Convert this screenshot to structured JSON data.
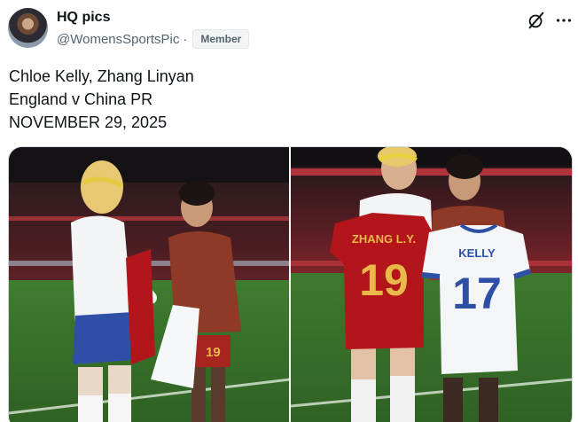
{
  "author": {
    "display_name": "HQ pics",
    "handle": "@WomensSportsPic",
    "separator": "·",
    "badge": "Member"
  },
  "actions": {
    "grok_icon": "grok-icon",
    "more_icon": "more-icon"
  },
  "tweet": {
    "lines": [
      "Chloe Kelly, Zhang Linyan",
      "England v China PR",
      "NOVEMBER 29, 2025"
    ]
  },
  "media": {
    "photo_left_shirt_number": "19",
    "photo_right_red_shirt_name": "ZHANG L.Y.",
    "photo_right_red_shirt_number": "19",
    "photo_right_white_shirt_name": "KELLY",
    "photo_right_white_shirt_number": "17"
  },
  "colors": {
    "text_primary": "#0f1419",
    "text_secondary": "#536471",
    "border": "#cfd9de",
    "pitch_green": "#3d7a2e",
    "china_red": "#b3151b",
    "england_white": "#f4f5f7",
    "gold": "#e9b94a"
  }
}
